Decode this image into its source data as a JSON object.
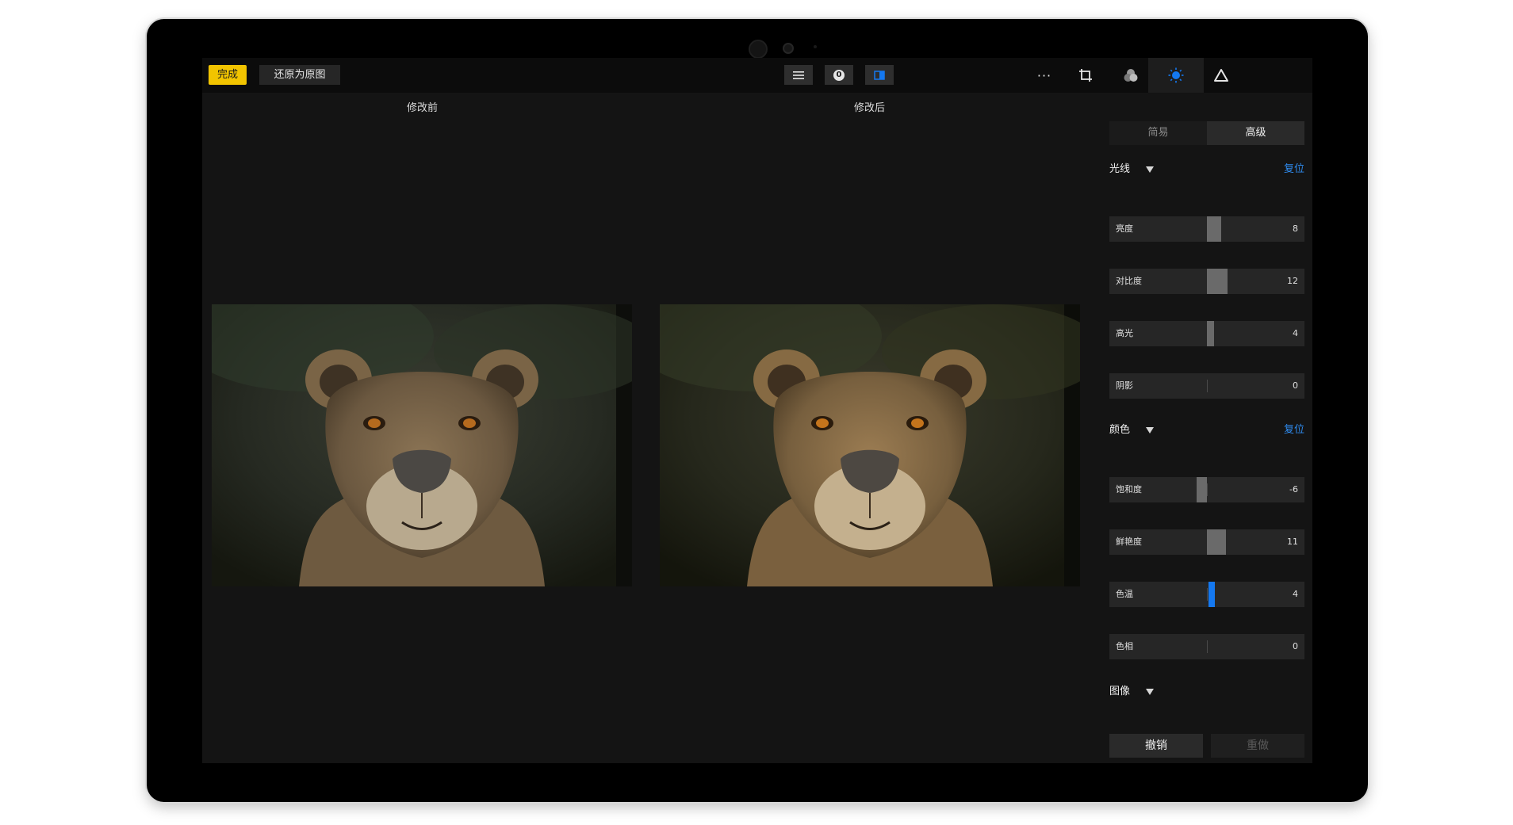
{
  "toolbar": {
    "done_label": "完成",
    "restore_label": "还原为原图",
    "history_count": "0",
    "more_label": "···"
  },
  "compare": {
    "before_label": "修改前",
    "after_label": "修改后"
  },
  "panel": {
    "mode_tabs": [
      "简易",
      "高级"
    ],
    "active_mode": "高级",
    "sections": {
      "light": {
        "title": "光线",
        "reset": "复位",
        "sliders": [
          {
            "label": "亮度",
            "value": "8",
            "level": 8
          },
          {
            "label": "对比度",
            "value": "12",
            "level": 12
          },
          {
            "label": "高光",
            "value": "4",
            "level": 4
          },
          {
            "label": "阴影",
            "value": "0",
            "level": 0
          }
        ]
      },
      "color": {
        "title": "颜色",
        "reset": "复位",
        "sliders": [
          {
            "label": "饱和度",
            "value": "-6",
            "level": -6
          },
          {
            "label": "鲜艳度",
            "value": "11",
            "level": 11
          },
          {
            "label": "色温",
            "value": "4",
            "level": 4
          },
          {
            "label": "色相",
            "value": "0",
            "level": 0
          }
        ]
      },
      "image": {
        "title": "图像"
      }
    },
    "undo_label": "撤销",
    "redo_label": "重做"
  },
  "colors": {
    "accent_yellow": "#f2c400",
    "accent_blue": "#1478f0",
    "link_blue": "#2f8cf0"
  }
}
